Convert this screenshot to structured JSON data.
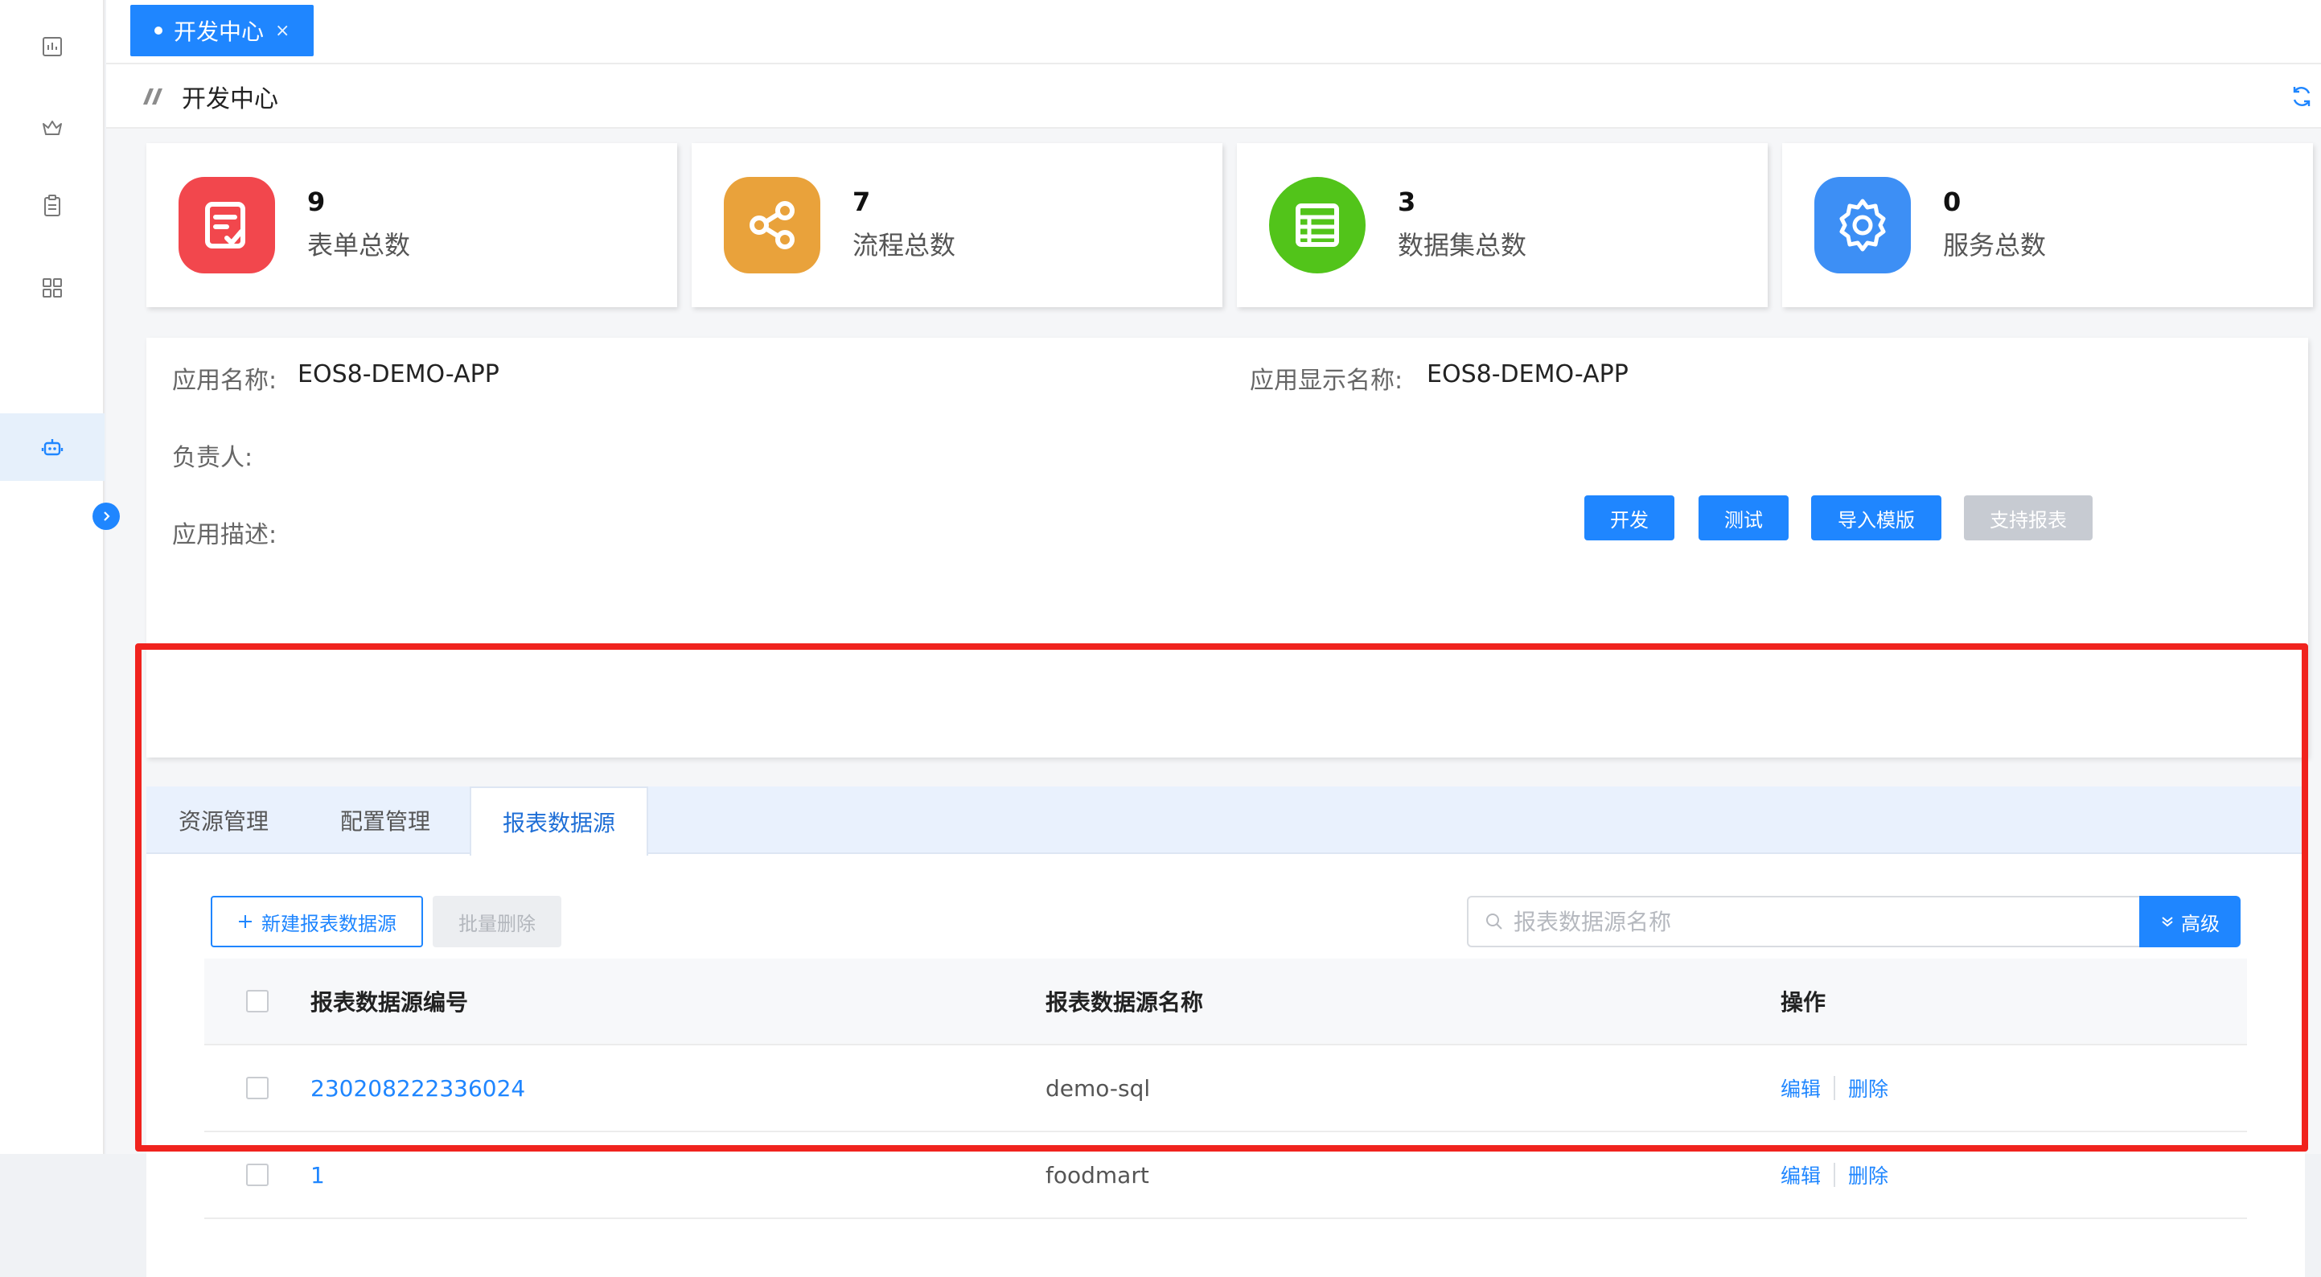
{
  "window_tab": {
    "label": "开发中心",
    "close": "×"
  },
  "page": {
    "title": "开发中心"
  },
  "sidebar": {
    "items": [
      {
        "icon": "chart-icon"
      },
      {
        "icon": "crown-icon"
      },
      {
        "icon": "clipboard-icon"
      },
      {
        "icon": "apps-icon"
      },
      {
        "icon": "robot-icon",
        "active": true
      }
    ]
  },
  "stats": [
    {
      "count": "9",
      "label": "表单总数",
      "icon": "form-icon",
      "color": "#f2474d"
    },
    {
      "count": "7",
      "label": "流程总数",
      "icon": "share-icon",
      "color": "#e9a23b"
    },
    {
      "count": "3",
      "label": "数据集总数",
      "icon": "table-icon",
      "color": "#52c41a"
    },
    {
      "count": "0",
      "label": "服务总数",
      "icon": "gear-icon",
      "color": "#3d8ff5"
    }
  ],
  "app_info": {
    "name_label": "应用名称:",
    "name_value": "EOS8-DEMO-APP",
    "display_name_label": "应用显示名称:",
    "display_name_value": "EOS8-DEMO-APP",
    "owner_label": "负责人:",
    "desc_label": "应用描述:",
    "buttons": {
      "develop": "开发",
      "test": "测试",
      "import_template": "导入模版",
      "support_report": "支持报表"
    }
  },
  "panel": {
    "tabs": [
      "资源管理",
      "配置管理",
      "报表数据源"
    ],
    "active_tab": "报表数据源",
    "toolbar": {
      "new_label": "新建报表数据源",
      "batch_delete_label": "批量删除",
      "search_placeholder": "报表数据源名称",
      "advanced_label": "高级"
    },
    "table": {
      "columns": [
        "报表数据源编号",
        "报表数据源名称",
        "操作"
      ],
      "rows": [
        {
          "code": "230208222336024",
          "name": "demo-sql",
          "edit": "编辑",
          "delete": "删除"
        },
        {
          "code": "1",
          "name": "foodmart",
          "edit": "编辑",
          "delete": "删除"
        }
      ]
    }
  },
  "colors": {
    "primary": "#1f86ff",
    "highlight": "#f0231e"
  }
}
